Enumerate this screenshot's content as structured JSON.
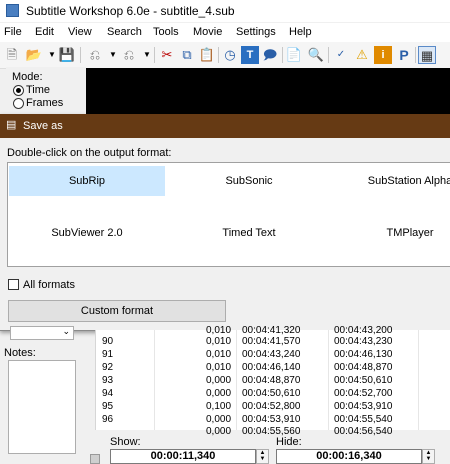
{
  "window": {
    "title": "Subtitle Workshop 6.0e - subtitle_4.sub"
  },
  "menu": [
    "File",
    "Edit",
    "View",
    "Search",
    "Tools",
    "Movie",
    "Settings",
    "Help"
  ],
  "toolbar": {
    "icons": [
      "new-icon",
      "open-icon",
      "dropdown-icon",
      "save-icon",
      "undo-icon",
      "dropdown-icon",
      "redo-icon",
      "dropdown-icon",
      "cut-icon",
      "copy-icon",
      "paste-icon",
      "clock-icon",
      "text-icon",
      "speech-icon",
      "translate-icon",
      "search-icon",
      "spellcheck-icon",
      "warning-icon",
      "info-icon",
      "p-icon",
      "film-icon"
    ]
  },
  "mode": {
    "label": "Mode:",
    "options": [
      "Time",
      "Frames"
    ],
    "selected": "Time"
  },
  "dialog": {
    "title": "Save as",
    "instruction": "Double-click on the output format:",
    "formats": [
      "SubRip",
      "SubSonic",
      "SubStation Alpha",
      "SubViewer 2.0",
      "Timed Text",
      "TMPlayer"
    ],
    "selected": "SubRip",
    "all_formats_label": "All formats",
    "all_formats_checked": false,
    "custom_button": "Custom format"
  },
  "notes_label": "Notes:",
  "grid": {
    "partial_row": {
      "pause": "0,010",
      "start": "00:04:41,320",
      "end": "00:04:43,200"
    },
    "rows": [
      {
        "num": "90",
        "pause": "0,010",
        "start": "00:04:41,570",
        "end": "00:04:43,230"
      },
      {
        "num": "91",
        "pause": "0,010",
        "start": "00:04:43,240",
        "end": "00:04:46,130"
      },
      {
        "num": "92",
        "pause": "0,010",
        "start": "00:04:46,140",
        "end": "00:04:48,870"
      },
      {
        "num": "93",
        "pause": "0,000",
        "start": "00:04:48,870",
        "end": "00:04:50,610"
      },
      {
        "num": "94",
        "pause": "0,000",
        "start": "00:04:50,610",
        "end": "00:04:52,700"
      },
      {
        "num": "95",
        "pause": "0,100",
        "start": "00:04:52,800",
        "end": "00:04:53,910"
      },
      {
        "num": "96",
        "pause": "0,000",
        "start": "00:04:53,910",
        "end": "00:04:55,540"
      }
    ],
    "last_partial": {
      "pause": "0,000",
      "start": "00:04:55,560",
      "end": "00:04:56,540"
    }
  },
  "bottom": {
    "show_label": "Show:",
    "show_value": "00:00:11,340",
    "hide_label": "Hide:",
    "hide_value": "00:00:16,340"
  }
}
